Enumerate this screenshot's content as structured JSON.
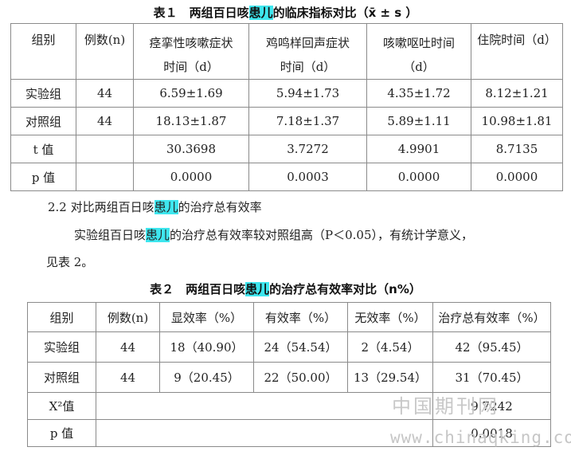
{
  "table1": {
    "caption_pre": "表１　两组百日咳",
    "caption_hl": "患儿",
    "caption_post": "的临床指标对比（x̄ ± s ）",
    "header": [
      "组别",
      "例数(n)",
      "痉挛性咳嗽症状时间（d）",
      "鸡鸣样回声症状时间（d）",
      "咳嗽呕吐时间（d）",
      "住院时间（d）"
    ],
    "rows": [
      [
        "实验组",
        "44",
        "6.59±1.69",
        "5.94±1.73",
        "4.35±1.72",
        "8.12±1.21"
      ],
      [
        "对照组",
        "44",
        "18.13±1.87",
        "7.18±1.37",
        "5.89±1.11",
        "10.98±1.81"
      ],
      [
        "t 值",
        "",
        "30.3698",
        "3.7272",
        "4.9901",
        "8.7135"
      ],
      [
        "p 值",
        "",
        "0.0000",
        "0.0003",
        "0.0000",
        "0.0000"
      ]
    ]
  },
  "section": {
    "heading_pre": "2.2 对比两组百日咳",
    "heading_hl": "患儿",
    "heading_post": "的治疗总有效率",
    "para1_pre": "实验组百日咳",
    "para1_hl": "患儿",
    "para1_post": "的治疗总有效率较对照组高（P＜0.05），有统计学意义，",
    "para2": "见表 2。"
  },
  "table2": {
    "caption_pre": "表２　两组百日咳",
    "caption_hl": "患儿",
    "caption_post": "的治疗总有效率对比（n%）",
    "header": [
      "组别",
      "例数(n)",
      "显效率（%）",
      "有效率（%）",
      "无效率（%）",
      "治疗总有效率（%）"
    ],
    "rows": [
      [
        "实验组",
        "44",
        "18（40.90）",
        "24（54.54）",
        "2（4.54）",
        "42（95.45）"
      ],
      [
        "对照组",
        "44",
        "9（20.45）",
        "22（50.00）",
        "13（29.54）",
        "31（70.45）"
      ]
    ],
    "chi_label": "X²值",
    "chi_value": "9.7242",
    "p_label": "p 值",
    "p_value": "0.0018"
  },
  "watermark": {
    "text_cn": "中国期刊网",
    "url": "www.chinaqking.com"
  }
}
